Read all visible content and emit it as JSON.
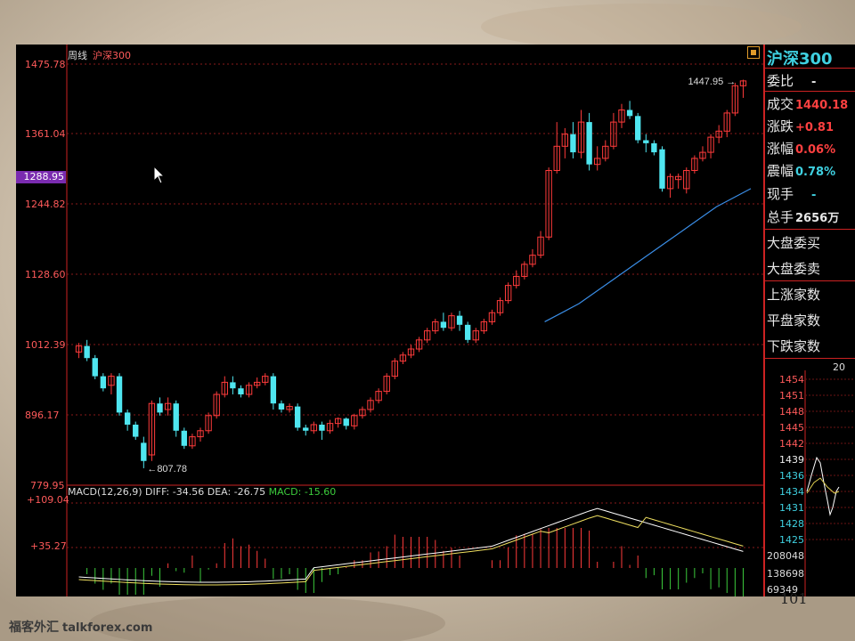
{
  "chart_header": {
    "period": "周线",
    "index": "沪深300"
  },
  "y_axis_labels": [
    "1475.78",
    "1361.04",
    "1288.95",
    "1244.82",
    "1128.60",
    "1012.39",
    "896.17",
    "779.95"
  ],
  "highlight_label": "1288.95",
  "annotations": {
    "high": "1447.95",
    "low": "807.78"
  },
  "macd": {
    "label": "MACD(12,26,9)",
    "diff": "DIFF: -34.56",
    "dea": "DEA: -26.75",
    "macd": "MACD: -15.60",
    "axis": [
      "+109.04",
      "+35.27"
    ]
  },
  "right_panel": {
    "title": "沪深300",
    "weibi_label": "委比",
    "weibi_value": "-",
    "chengjiao_label": "成交",
    "chengjiao_value": "1440.18",
    "zhangdie_label": "涨跌",
    "zhangdie_value": "+0.81",
    "zhangfu_label": "涨幅",
    "zhangfu_value": "0.06%",
    "zhenfu_label": "震幅",
    "zhenfu_value": "0.78%",
    "xianshou_label": "现手",
    "xianshou_value": "-",
    "zongshou_label": "总手",
    "zongshou_value": "2656万",
    "dapan_weimai": "大盘委买",
    "dapan_weimai_value": "",
    "dapan_weimai2": "大盘委卖",
    "shangzhang": "上涨家数",
    "pingpan": "平盘家数",
    "xiadie": "下跌家数",
    "mini_label": "20",
    "mini_prices": [
      "1454",
      "1451",
      "1448",
      "1445",
      "1442",
      "1439",
      "1436",
      "1434",
      "1431",
      "1428",
      "1425"
    ],
    "mini_vol": [
      "208048",
      "138698",
      "69349"
    ]
  },
  "watermark": {
    "cn": "福客外汇",
    "site": "talkforex.com"
  },
  "page_number": "101",
  "chart_data": {
    "type": "candlestick",
    "title": "",
    "ylim": [
      779.95,
      1475.78
    ],
    "candles": [
      {
        "o": 1000,
        "c": 1010,
        "h": 1015,
        "l": 990
      },
      {
        "o": 1010,
        "c": 990,
        "h": 1020,
        "l": 985
      },
      {
        "o": 990,
        "c": 960,
        "h": 995,
        "l": 955
      },
      {
        "o": 960,
        "c": 940,
        "h": 965,
        "l": 935
      },
      {
        "o": 945,
        "c": 960,
        "h": 965,
        "l": 930
      },
      {
        "o": 960,
        "c": 900,
        "h": 965,
        "l": 895
      },
      {
        "o": 900,
        "c": 880,
        "h": 905,
        "l": 870
      },
      {
        "o": 880,
        "c": 860,
        "h": 885,
        "l": 855
      },
      {
        "o": 850,
        "c": 820,
        "h": 860,
        "l": 808
      },
      {
        "o": 830,
        "c": 915,
        "h": 920,
        "l": 820
      },
      {
        "o": 915,
        "c": 900,
        "h": 925,
        "l": 895
      },
      {
        "o": 905,
        "c": 915,
        "h": 925,
        "l": 895
      },
      {
        "o": 915,
        "c": 870,
        "h": 920,
        "l": 860
      },
      {
        "o": 870,
        "c": 845,
        "h": 875,
        "l": 840
      },
      {
        "o": 845,
        "c": 860,
        "h": 865,
        "l": 840
      },
      {
        "o": 860,
        "c": 870,
        "h": 875,
        "l": 852
      },
      {
        "o": 870,
        "c": 895,
        "h": 900,
        "l": 865
      },
      {
        "o": 895,
        "c": 930,
        "h": 935,
        "l": 890
      },
      {
        "o": 930,
        "c": 950,
        "h": 960,
        "l": 925
      },
      {
        "o": 950,
        "c": 940,
        "h": 960,
        "l": 930
      },
      {
        "o": 940,
        "c": 930,
        "h": 945,
        "l": 925
      },
      {
        "o": 930,
        "c": 945,
        "h": 950,
        "l": 925
      },
      {
        "o": 945,
        "c": 950,
        "h": 958,
        "l": 940
      },
      {
        "o": 950,
        "c": 960,
        "h": 965,
        "l": 945
      },
      {
        "o": 960,
        "c": 915,
        "h": 965,
        "l": 905
      },
      {
        "o": 915,
        "c": 905,
        "h": 920,
        "l": 900
      },
      {
        "o": 905,
        "c": 910,
        "h": 915,
        "l": 900
      },
      {
        "o": 910,
        "c": 875,
        "h": 915,
        "l": 870
      },
      {
        "o": 875,
        "c": 870,
        "h": 880,
        "l": 862
      },
      {
        "o": 870,
        "c": 880,
        "h": 885,
        "l": 865
      },
      {
        "o": 880,
        "c": 870,
        "h": 885,
        "l": 855
      },
      {
        "o": 870,
        "c": 882,
        "h": 888,
        "l": 865
      },
      {
        "o": 882,
        "c": 890,
        "h": 892,
        "l": 875
      },
      {
        "o": 890,
        "c": 878,
        "h": 892,
        "l": 872
      },
      {
        "o": 878,
        "c": 895,
        "h": 898,
        "l": 872
      },
      {
        "o": 895,
        "c": 905,
        "h": 910,
        "l": 890
      },
      {
        "o": 905,
        "c": 920,
        "h": 925,
        "l": 900
      },
      {
        "o": 920,
        "c": 935,
        "h": 940,
        "l": 915
      },
      {
        "o": 935,
        "c": 960,
        "h": 965,
        "l": 930
      },
      {
        "o": 960,
        "c": 985,
        "h": 990,
        "l": 955
      },
      {
        "o": 985,
        "c": 995,
        "h": 1000,
        "l": 980
      },
      {
        "o": 995,
        "c": 1005,
        "h": 1012,
        "l": 990
      },
      {
        "o": 1005,
        "c": 1020,
        "h": 1025,
        "l": 1000
      },
      {
        "o": 1020,
        "c": 1035,
        "h": 1040,
        "l": 1015
      },
      {
        "o": 1035,
        "c": 1050,
        "h": 1055,
        "l": 1030
      },
      {
        "o": 1050,
        "c": 1040,
        "h": 1065,
        "l": 1035
      },
      {
        "o": 1040,
        "c": 1060,
        "h": 1065,
        "l": 1035
      },
      {
        "o": 1060,
        "c": 1045,
        "h": 1068,
        "l": 1035
      },
      {
        "o": 1045,
        "c": 1020,
        "h": 1050,
        "l": 1015
      },
      {
        "o": 1020,
        "c": 1035,
        "h": 1040,
        "l": 1015
      },
      {
        "o": 1035,
        "c": 1050,
        "h": 1055,
        "l": 1030
      },
      {
        "o": 1050,
        "c": 1065,
        "h": 1070,
        "l": 1045
      },
      {
        "o": 1065,
        "c": 1085,
        "h": 1090,
        "l": 1060
      },
      {
        "o": 1085,
        "c": 1110,
        "h": 1115,
        "l": 1080
      },
      {
        "o": 1110,
        "c": 1125,
        "h": 1135,
        "l": 1105
      },
      {
        "o": 1125,
        "c": 1145,
        "h": 1150,
        "l": 1120
      },
      {
        "o": 1145,
        "c": 1160,
        "h": 1170,
        "l": 1140
      },
      {
        "o": 1160,
        "c": 1190,
        "h": 1200,
        "l": 1155
      },
      {
        "o": 1190,
        "c": 1300,
        "h": 1305,
        "l": 1185
      },
      {
        "o": 1300,
        "c": 1340,
        "h": 1380,
        "l": 1295
      },
      {
        "o": 1340,
        "c": 1360,
        "h": 1370,
        "l": 1320
      },
      {
        "o": 1360,
        "c": 1330,
        "h": 1380,
        "l": 1320
      },
      {
        "o": 1330,
        "c": 1380,
        "h": 1400,
        "l": 1320
      },
      {
        "o": 1380,
        "c": 1310,
        "h": 1395,
        "l": 1300
      },
      {
        "o": 1310,
        "c": 1320,
        "h": 1340,
        "l": 1300
      },
      {
        "o": 1320,
        "c": 1340,
        "h": 1350,
        "l": 1315
      },
      {
        "o": 1340,
        "c": 1380,
        "h": 1395,
        "l": 1335
      },
      {
        "o": 1380,
        "c": 1400,
        "h": 1410,
        "l": 1370
      },
      {
        "o": 1400,
        "c": 1390,
        "h": 1415,
        "l": 1385
      },
      {
        "o": 1390,
        "c": 1350,
        "h": 1395,
        "l": 1345
      },
      {
        "o": 1350,
        "c": 1345,
        "h": 1360,
        "l": 1330
      },
      {
        "o": 1345,
        "c": 1330,
        "h": 1350,
        "l": 1325
      },
      {
        "o": 1335,
        "c": 1270,
        "h": 1340,
        "l": 1265
      },
      {
        "o": 1270,
        "c": 1290,
        "h": 1295,
        "l": 1255
      },
      {
        "o": 1285,
        "c": 1290,
        "h": 1295,
        "l": 1270
      },
      {
        "o": 1270,
        "c": 1300,
        "h": 1305,
        "l": 1262
      },
      {
        "o": 1300,
        "c": 1320,
        "h": 1325,
        "l": 1295
      },
      {
        "o": 1320,
        "c": 1330,
        "h": 1340,
        "l": 1315
      },
      {
        "o": 1330,
        "c": 1355,
        "h": 1360,
        "l": 1320
      },
      {
        "o": 1355,
        "c": 1365,
        "h": 1375,
        "l": 1345
      },
      {
        "o": 1365,
        "c": 1395,
        "h": 1400,
        "l": 1355
      },
      {
        "o": 1395,
        "c": 1440,
        "h": 1445,
        "l": 1390
      },
      {
        "o": 1440,
        "c": 1448,
        "h": 1450,
        "l": 1420
      }
    ],
    "ma_line_y": [
      1050,
      1080,
      1120,
      1160,
      1200,
      1240,
      1270
    ]
  }
}
